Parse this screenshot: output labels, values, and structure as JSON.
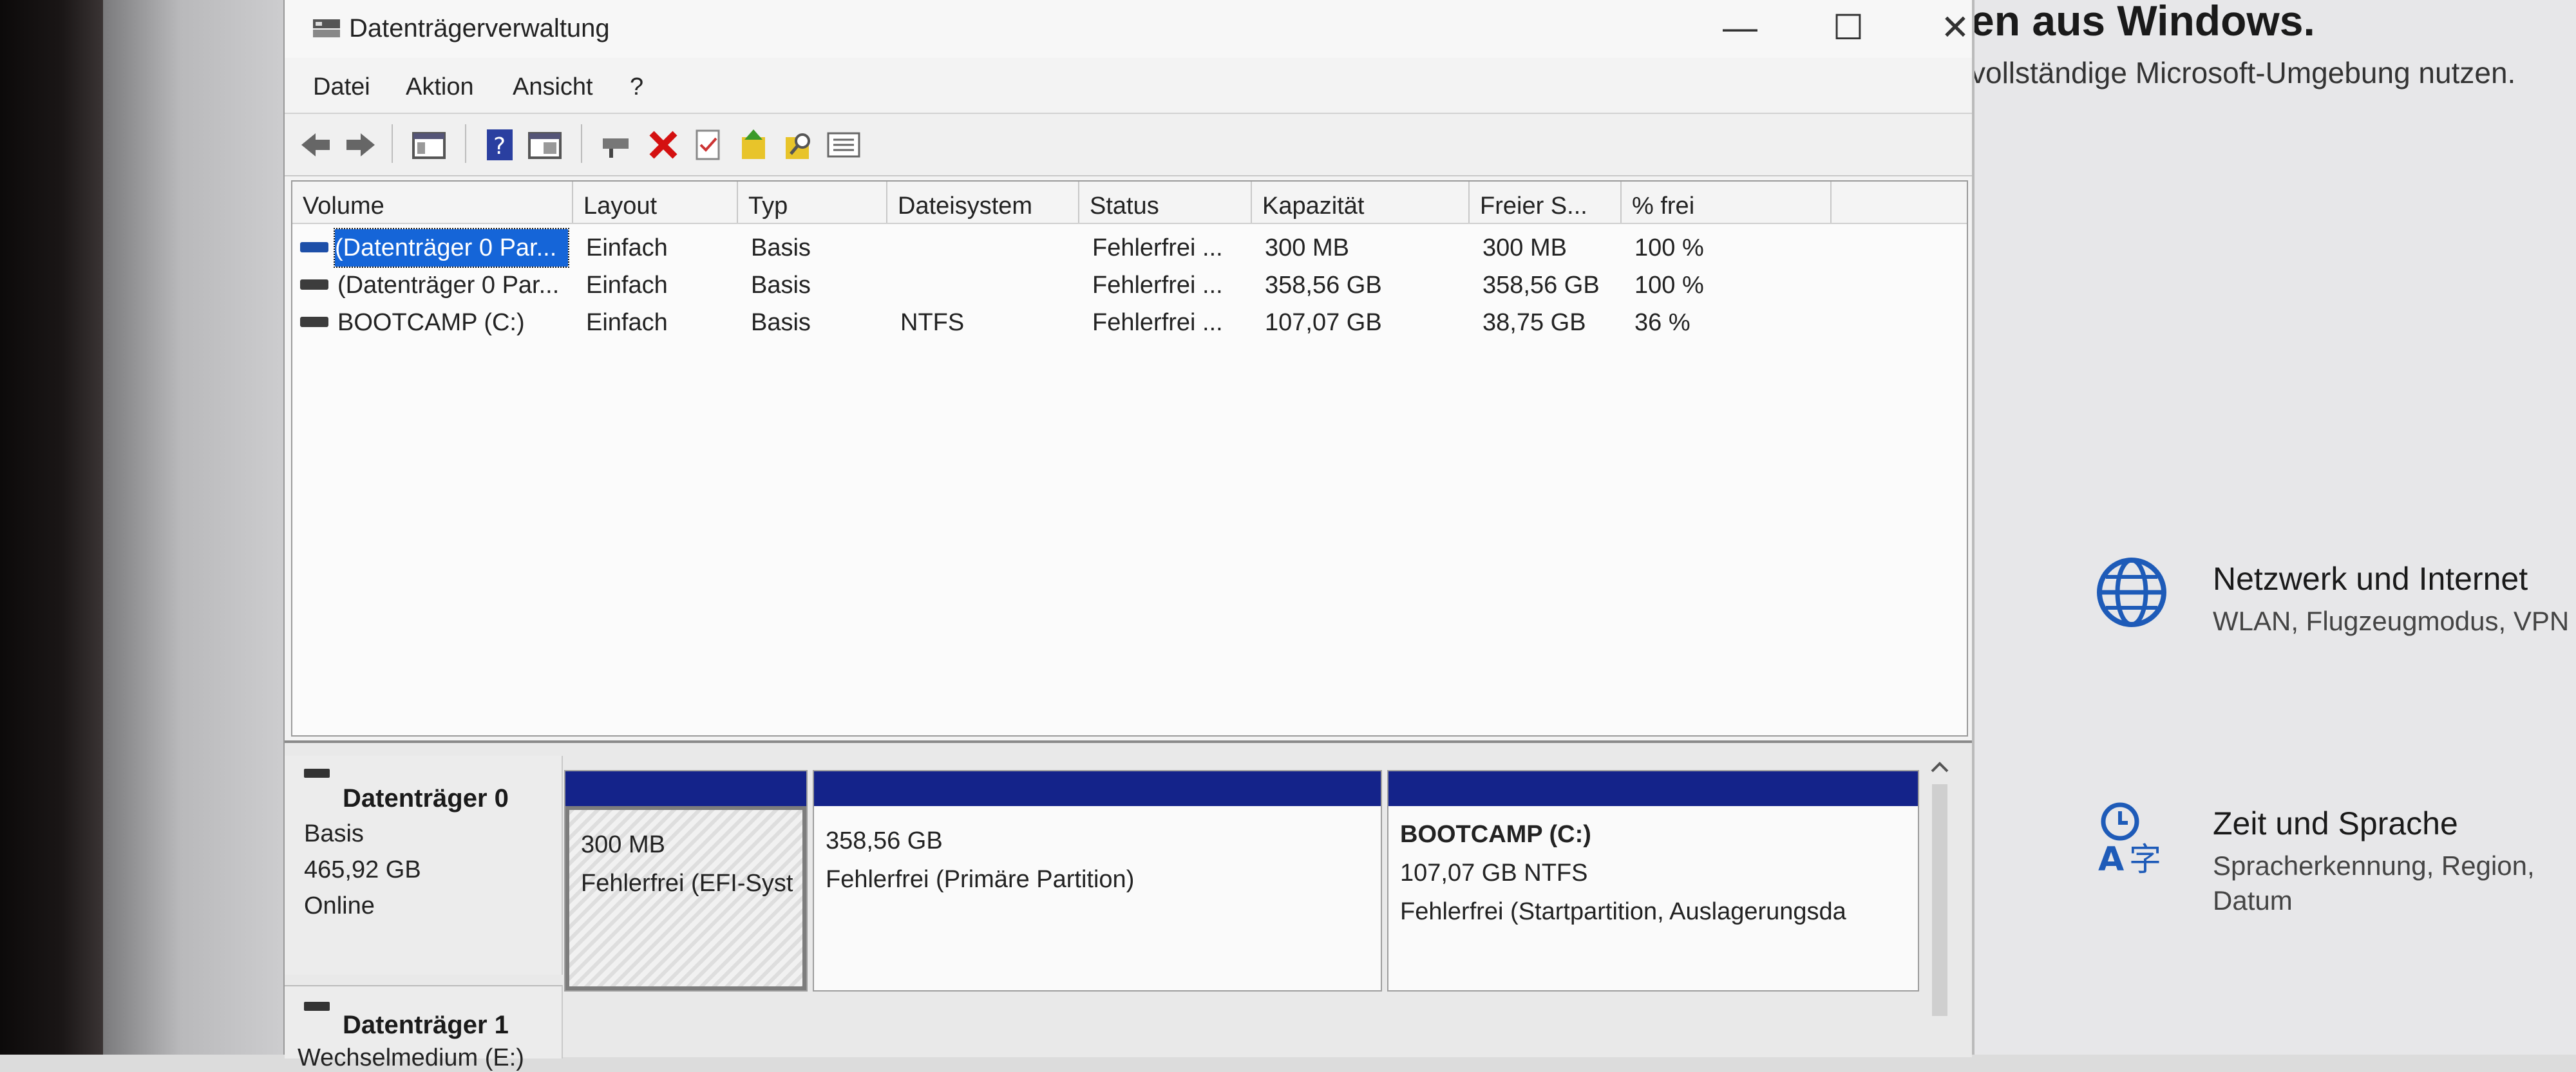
{
  "settings": {
    "title_fragment": "en aus Windows.",
    "subtitle_fragment": "vollständige Microsoft-Umgebung nutzen.",
    "items": [
      {
        "title": "Netzwerk und Internet",
        "desc": "WLAN, Flugzeugmodus, VPN",
        "icon": "globe-icon"
      },
      {
        "title": "Zeit und Sprache",
        "desc": "Spracherkennung, Region, Datum",
        "icon": "time-language-icon"
      }
    ]
  },
  "window": {
    "title": "Datenträgerverwaltung",
    "controls": {
      "minimize": "—",
      "maximize": "☐",
      "close": "✕"
    }
  },
  "menu": [
    "Datei",
    "Aktion",
    "Ansicht",
    "?"
  ],
  "toolbar": [
    "back-icon",
    "forward-icon",
    "console-tree-icon",
    "help-icon",
    "properties-icon",
    "connect-icon",
    "delete-icon",
    "check-icon",
    "import-icon",
    "search-icon",
    "list-icon"
  ],
  "table": {
    "columns": [
      "Volume",
      "Layout",
      "Typ",
      "Dateisystem",
      "Status",
      "Kapazität",
      "Freier S...",
      "% frei"
    ],
    "rows": [
      {
        "volume": "(Datenträger 0 Par...",
        "layout": "Einfach",
        "typ": "Basis",
        "fs": "",
        "status": "Fehlerfrei ...",
        "cap": "300 MB",
        "free": "300 MB",
        "pct": "100 %"
      },
      {
        "volume": "(Datenträger 0 Par...",
        "layout": "Einfach",
        "typ": "Basis",
        "fs": "",
        "status": "Fehlerfrei ...",
        "cap": "358,56 GB",
        "free": "358,56 GB",
        "pct": "100 %"
      },
      {
        "volume": "BOOTCAMP (C:)",
        "layout": "Einfach",
        "typ": "Basis",
        "fs": "NTFS",
        "status": "Fehlerfrei ...",
        "cap": "107,07 GB",
        "free": "38,75 GB",
        "pct": "36 %"
      }
    ]
  },
  "disks": [
    {
      "name": "Datenträger 0",
      "type": "Basis",
      "size": "465,92 GB",
      "state": "Online",
      "partitions": [
        {
          "l1": "300 MB",
          "l2": "Fehlerfrei (EFI-Syst"
        },
        {
          "l1": "358,56 GB",
          "l2": "Fehlerfrei (Primäre Partition)"
        },
        {
          "l0": "BOOTCAMP  (C:)",
          "l1": "107,07 GB NTFS",
          "l2": "Fehlerfrei (Startpartition, Auslagerungsda"
        }
      ]
    },
    {
      "name": "Datenträger 1",
      "type": "Wechselmedium (E:)"
    }
  ]
}
